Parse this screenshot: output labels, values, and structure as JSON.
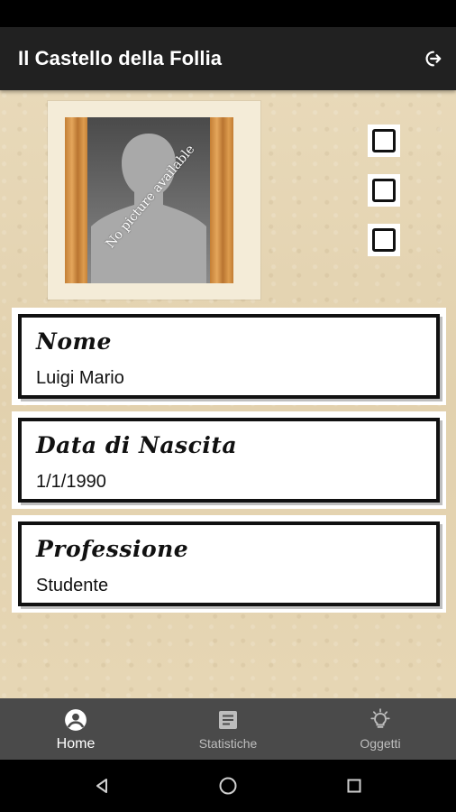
{
  "app": {
    "title": "Il Castello della Follia"
  },
  "profile": {
    "photo_caption": "No picture available",
    "checkboxes": [
      false,
      false,
      false
    ],
    "fields": [
      {
        "label": "Nome",
        "value": "Luigi Mario"
      },
      {
        "label": "Data di Nascita",
        "value": "1/1/1990"
      },
      {
        "label": "Professione",
        "value": "Studente"
      }
    ]
  },
  "bottom_nav": {
    "items": [
      {
        "label": "Home",
        "icon": "account-circle-icon",
        "active": true
      },
      {
        "label": "Statistiche",
        "icon": "list-document-icon",
        "active": false
      },
      {
        "label": "Oggetti",
        "icon": "lightbulb-icon",
        "active": false
      }
    ]
  },
  "colors": {
    "appbar": "#212121",
    "background": "#e4d4b2",
    "bottom_nav": "#4a4a4a"
  }
}
